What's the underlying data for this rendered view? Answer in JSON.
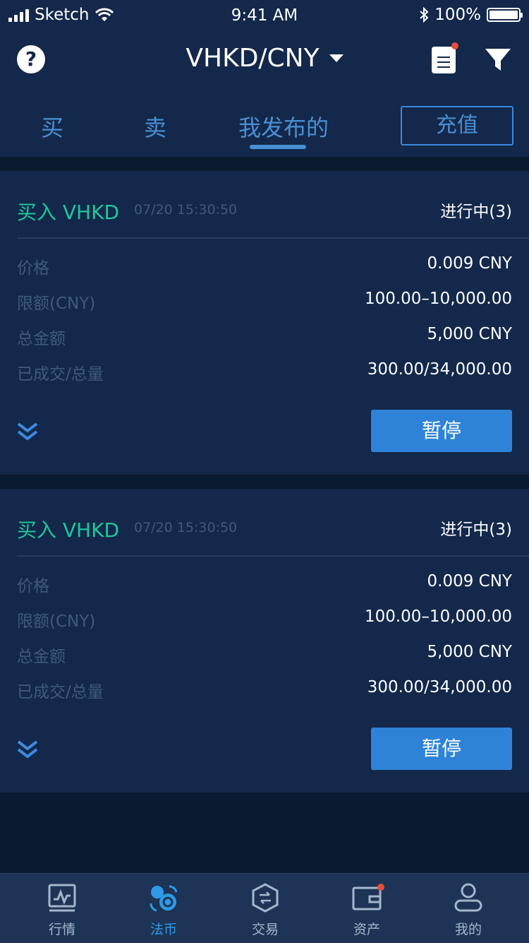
{
  "status_bar": {
    "carrier": "Sketch",
    "time": "9:41 AM",
    "battery": "100%"
  },
  "nav": {
    "title": "VHKD/CNY",
    "help_icon": "?"
  },
  "tabs": [
    {
      "label": "买",
      "active": false
    },
    {
      "label": "卖",
      "active": false
    },
    {
      "label": "我发布的",
      "active": true
    }
  ],
  "recharge_label": "充值",
  "orders": [
    {
      "title": "买入 VHKD",
      "time": "07/20 15:30:50",
      "status": "进行中(3)",
      "rows": [
        {
          "label": "价格",
          "value": "0.009 CNY"
        },
        {
          "label": "限额(CNY)",
          "value": "100.00–10,000.00"
        },
        {
          "label": "总金额",
          "value": "5,000 CNY"
        },
        {
          "label": "已成交/总量",
          "value": "300.00/34,000.00"
        }
      ],
      "action_label": "暂停"
    },
    {
      "title": "买入 VHKD",
      "time": "07/20 15:30:50",
      "status": "进行中(3)",
      "rows": [
        {
          "label": "价格",
          "value": "0.009 CNY"
        },
        {
          "label": "限额(CNY)",
          "value": "100.00–10,000.00"
        },
        {
          "label": "总金额",
          "value": "5,000 CNY"
        },
        {
          "label": "已成交/总量",
          "value": "300.00/34,000.00"
        }
      ],
      "action_label": "暂停"
    }
  ],
  "tabbar": [
    {
      "label": "行情",
      "icon": "market-chart-icon",
      "active": false
    },
    {
      "label": "法币",
      "icon": "fiat-exchange-icon",
      "active": true
    },
    {
      "label": "交易",
      "icon": "trade-hexagon-icon",
      "active": false
    },
    {
      "label": "资产",
      "icon": "wallet-icon",
      "active": false,
      "badge": true
    },
    {
      "label": "我的",
      "icon": "user-icon",
      "active": false
    }
  ],
  "colors": {
    "accent": "#2e83d8",
    "buy": "#1fc79b",
    "badge": "#e74c3c",
    "card": "#13284a",
    "bg": "#0a1a30"
  }
}
